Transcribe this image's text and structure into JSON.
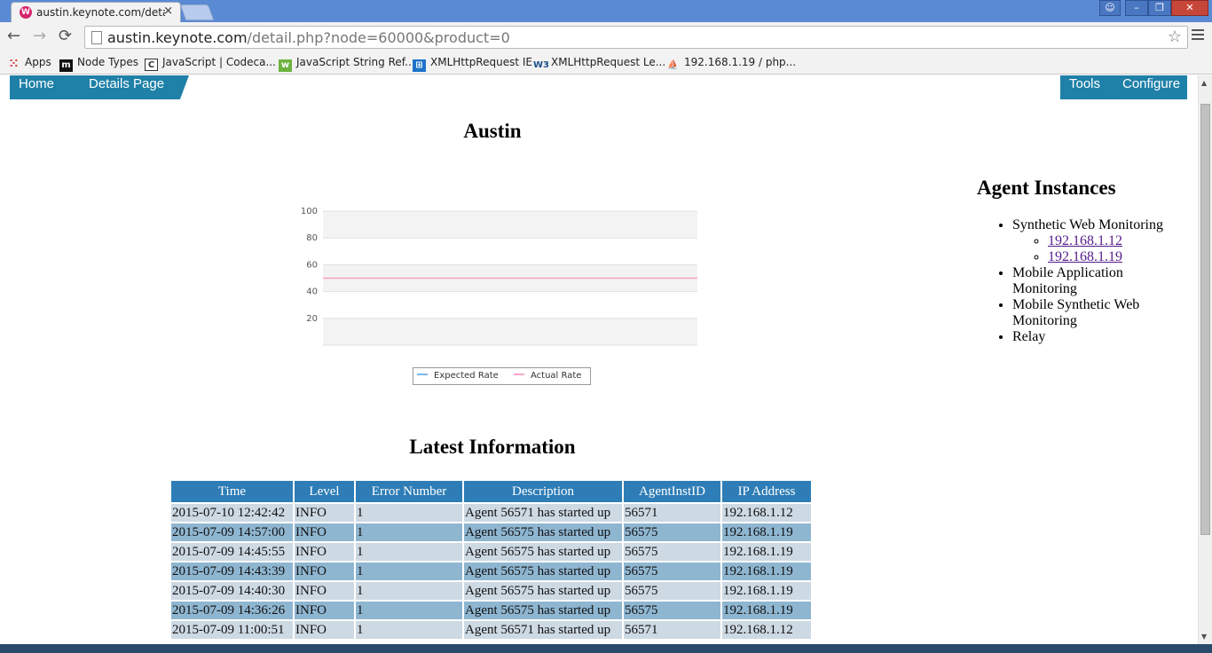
{
  "browser": {
    "tab_title": "austin.keynote.com/detail",
    "favicon_letter": "W",
    "url_host": "austin.keynote.com",
    "url_path": "/detail.php?node=60000&product=0",
    "close_glyph": "×",
    "star_glyph": "☆",
    "back_glyph": "←",
    "forward_glyph": "→",
    "reload_glyph": "⟳"
  },
  "bookmarks": [
    {
      "label": "Apps",
      "icon": "apps-grid-icon"
    },
    {
      "label": "Node Types",
      "icon": "m-logo-icon"
    },
    {
      "label": "JavaScript | Codeca...",
      "icon": "codecademy-icon"
    },
    {
      "label": "JavaScript String Ref...",
      "icon": "w3schools-icon"
    },
    {
      "label": "XMLHttpRequest IE",
      "icon": "windows-icon"
    },
    {
      "label": "XMLHttpRequest Le...",
      "icon": "w3c-icon"
    },
    {
      "label": "192.168.1.19 / php...",
      "icon": "phpmyadmin-icon"
    }
  ],
  "nav": {
    "home": "Home",
    "details": "Details Page",
    "tools": "Tools",
    "configure": "Configure"
  },
  "page_title": "Austin",
  "chart_data": {
    "type": "line",
    "title": "",
    "xlabel": "",
    "ylabel": "",
    "ylim": [
      0,
      100
    ],
    "yticks": [
      20,
      40,
      60,
      80,
      100
    ],
    "grid": true,
    "legend_position": "bottom",
    "series": [
      {
        "name": "Expected Rate",
        "color": "#7cb5ec",
        "values": []
      },
      {
        "name": "Actual Rate",
        "color": "#f7a3c8",
        "values": [
          50,
          50
        ]
      }
    ]
  },
  "latest": {
    "title": "Latest Information",
    "headers": [
      "Time",
      "Level",
      "Error Number",
      "Description",
      "AgentInstID",
      "IP Address"
    ],
    "rows": [
      [
        "2015-07-10 12:42:42",
        "INFO",
        "1",
        "Agent 56571 has started up",
        "56571",
        "192.168.1.12"
      ],
      [
        "2015-07-09 14:57:00",
        "INFO",
        "1",
        "Agent 56575 has started up",
        "56575",
        "192.168.1.19"
      ],
      [
        "2015-07-09 14:45:55",
        "INFO",
        "1",
        "Agent 56575 has started up",
        "56575",
        "192.168.1.19"
      ],
      [
        "2015-07-09 14:43:39",
        "INFO",
        "1",
        "Agent 56575 has started up",
        "56575",
        "192.168.1.19"
      ],
      [
        "2015-07-09 14:40:30",
        "INFO",
        "1",
        "Agent 56575 has started up",
        "56575",
        "192.168.1.19"
      ],
      [
        "2015-07-09 14:36:26",
        "INFO",
        "1",
        "Agent 56575 has started up",
        "56575",
        "192.168.1.19"
      ],
      [
        "2015-07-09 11:00:51",
        "INFO",
        "1",
        "Agent 56571 has started up",
        "56571",
        "192.168.1.12"
      ]
    ]
  },
  "agents": {
    "title": "Agent Instances",
    "synthetic": "Synthetic Web Monitoring",
    "ips": [
      "192.168.1.12",
      "192.168.1.19"
    ],
    "mobile_app": "Mobile Application Monitoring",
    "mobile_synthetic": "Mobile Synthetic Web Monitoring",
    "relay": "Relay"
  }
}
